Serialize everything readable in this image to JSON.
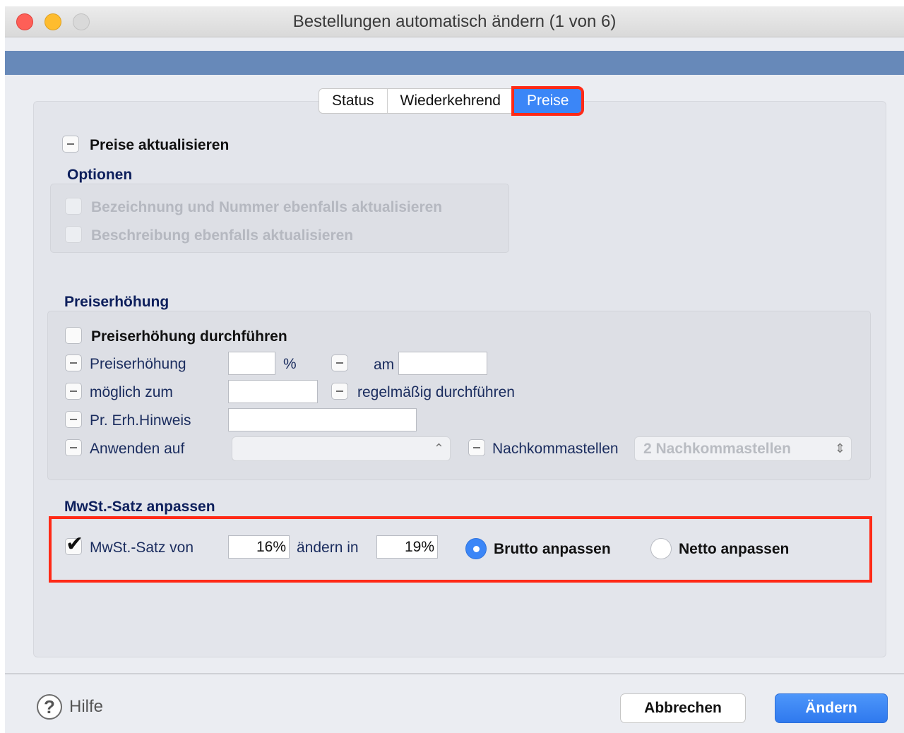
{
  "window": {
    "title": "Bestellungen automatisch ändern (1 von 6)"
  },
  "tabs": [
    {
      "label": "Status",
      "active": false
    },
    {
      "label": "Wiederkehrend",
      "active": false
    },
    {
      "label": "Preise",
      "active": true
    }
  ],
  "preise": {
    "update_label": "Preise aktualisieren",
    "options_title": "Optionen",
    "option1": "Bezeichnung und Nummer ebenfalls aktualisieren",
    "option2": "Beschreibung ebenfalls aktualisieren"
  },
  "preiserhoehung": {
    "title": "Preiserhöhung",
    "perform_label": "Preiserhöhung durchführen",
    "increase_label": "Preiserhöhung",
    "increase_value": "",
    "percent": "%",
    "am_label": "am",
    "am_value": "",
    "moeglich_label": "möglich zum",
    "moeglich_value": "",
    "regelmaessig_label": "regelmäßig durchführen",
    "hinweis_label": "Pr. Erh.Hinweis",
    "hinweis_value": "",
    "anwenden_label": "Anwenden auf",
    "anwenden_value": "",
    "nachkomma_label": "Nachkommastellen",
    "nachkomma_value": "2 Nachkommastellen"
  },
  "mwst": {
    "title": "MwSt.-Satz anpassen",
    "von_label": "MwSt.-Satz von",
    "von_value": "16%",
    "aendern_label": "ändern in",
    "neu_value": "19%",
    "brutto_label": "Brutto anpassen",
    "netto_label": "Netto anpassen",
    "selected": "brutto"
  },
  "footer": {
    "help_label": "Hilfe",
    "cancel_label": "Abbrechen",
    "ok_label": "Ändern"
  },
  "colors": {
    "accent": "#3b86f7",
    "highlight": "#ff2a17",
    "header_bar": "#6789b9"
  }
}
